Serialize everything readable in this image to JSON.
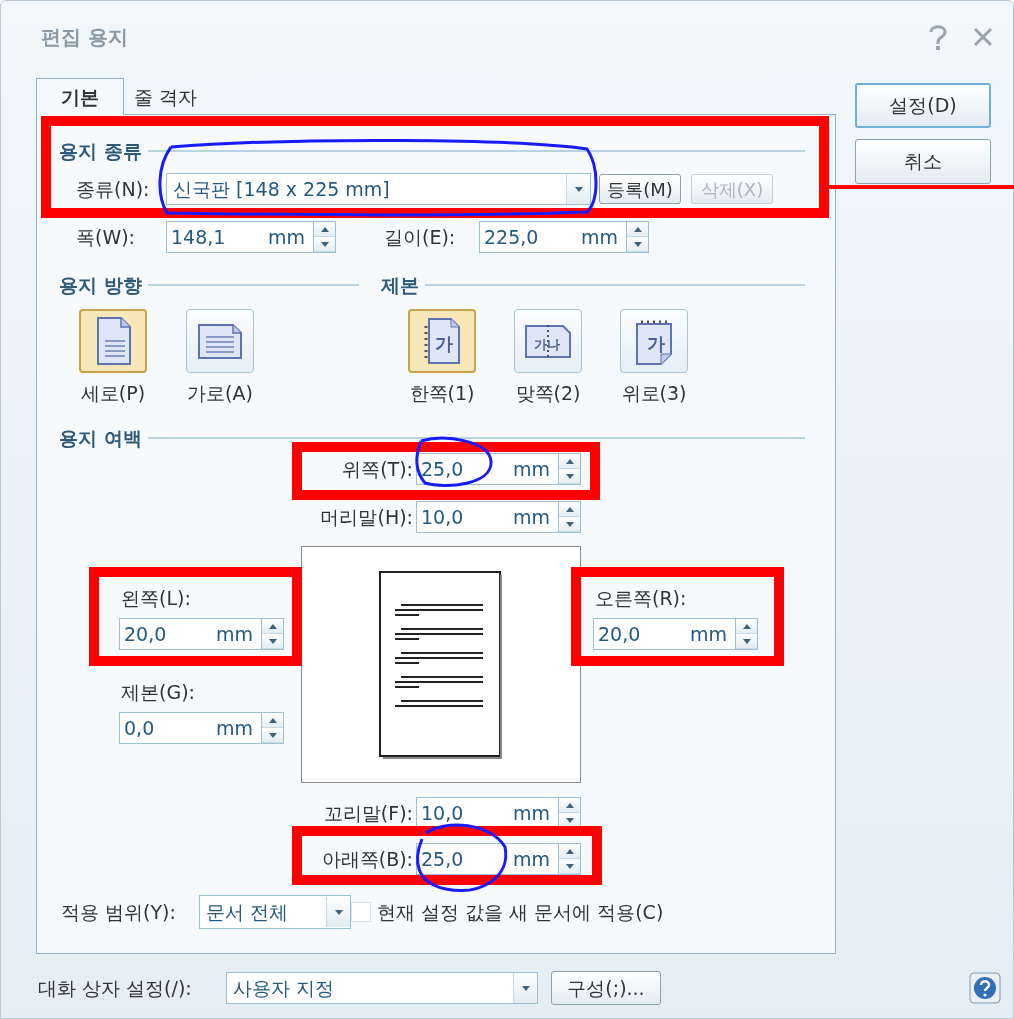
{
  "window": {
    "title": "편집 용지"
  },
  "tabs": [
    {
      "label": "기본",
      "selected": true
    },
    {
      "label": "줄 격자",
      "selected": false
    }
  ],
  "paper_type": {
    "heading": "용지 종류",
    "type_label": "종류(N):",
    "type_value": "신국판  [148 x 225 mm]",
    "register_button": {
      "label": "등록(M)",
      "disabled": false
    },
    "delete_button": {
      "label": "삭제(X)",
      "disabled": true
    },
    "width": {
      "label": "폭(W):",
      "value": "148,1",
      "unit": "mm"
    },
    "length": {
      "label": "길이(E):",
      "value": "225,0",
      "unit": "mm"
    }
  },
  "orientation": {
    "heading": "용지 방향",
    "options": [
      {
        "label": "세로(P)",
        "kind": "portrait",
        "selected": true
      },
      {
        "label": "가로(A)",
        "kind": "landscape",
        "selected": false
      }
    ]
  },
  "binding": {
    "heading": "제본",
    "options": [
      {
        "label": "한쪽(1)",
        "kind": "single",
        "icon_text": "가",
        "selected": true
      },
      {
        "label": "맞쪽(2)",
        "kind": "facing",
        "icon_text": "가나",
        "selected": false
      },
      {
        "label": "위로(3)",
        "kind": "top",
        "icon_text": "가",
        "selected": false
      }
    ]
  },
  "margins": {
    "heading": "용지 여백",
    "top": {
      "label": "위쪽(T):",
      "value": "25,0",
      "unit": "mm"
    },
    "header": {
      "label": "머리말(H):",
      "value": "10,0",
      "unit": "mm"
    },
    "left": {
      "label": "왼쪽(L):",
      "value": "20,0",
      "unit": "mm"
    },
    "gutter": {
      "label": "제본(G):",
      "value": "0,0",
      "unit": "mm"
    },
    "right": {
      "label": "오른쪽(R):",
      "value": "20,0",
      "unit": "mm"
    },
    "footer": {
      "label": "꼬리말(F):",
      "value": "10,0",
      "unit": "mm"
    },
    "bottom": {
      "label": "아래쪽(B):",
      "value": "25,0",
      "unit": "mm"
    }
  },
  "apply_scope": {
    "label": "적용 범위(Y):",
    "value": "문서 전체"
  },
  "apply_to_new": {
    "label": "현재 설정 값을 새 문서에 적용(C)",
    "checked": false
  },
  "buttons": [
    {
      "label": "설정(D)",
      "default": true
    },
    {
      "label": "취소",
      "default": false
    }
  ],
  "dialog_settings": {
    "label": "대화 상자 설정(/):",
    "value": "사용자 지정",
    "configure_button": "구성(;)..."
  }
}
